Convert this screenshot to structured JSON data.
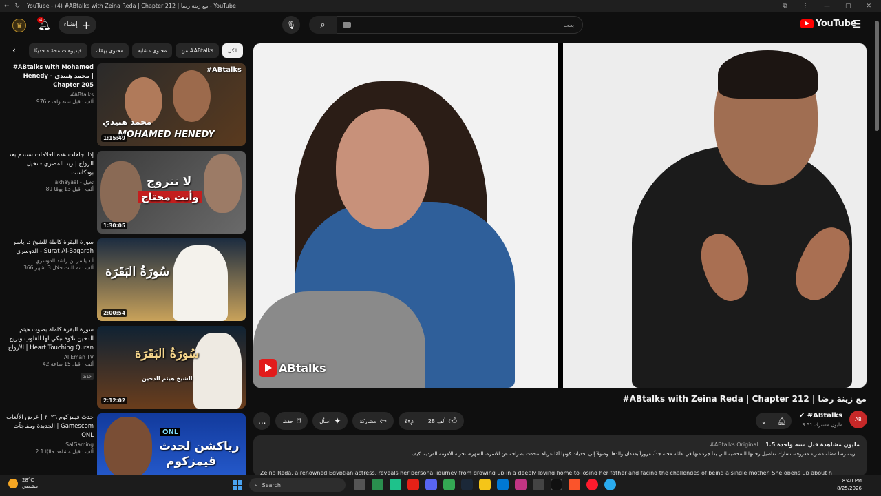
{
  "window": {
    "title": "YouTube - (4) #ABtalks with Zeina Reda | Chapter 212 | مع زينة رضا - YouTube"
  },
  "header": {
    "notifications_count": "4",
    "create_label": "إنشاء",
    "search_placeholder": "بحث",
    "logo_text": "YouTube"
  },
  "chips": [
    {
      "label": "الكل",
      "active": true
    },
    {
      "label": "من #ABtalks"
    },
    {
      "label": "محتوى مشابه"
    },
    {
      "label": "محتوى يهمّك"
    },
    {
      "label": "فيديوهات محمّلة حديثًا"
    }
  ],
  "recommendations": [
    {
      "title": "#ABtalks with Mohamed Henedy - محمد هنيدي | Chapter 205",
      "channel": "#ABtalks",
      "views": "976 ألف",
      "age": "قبل سنة واحدة",
      "duration": "1:15:49",
      "thumb_text1": "#ABtalks",
      "thumb_text2": "محمد هنيدي",
      "thumb_text3": "MOHAMED HENEDY"
    },
    {
      "title": "إذا تجاهلت هذه العلامات ستندم بعد الزواج | زيد المصري - تخيل بودكاست",
      "channel": "Takhayaal - تخيل",
      "views": "89 ألف",
      "age": "قبل 13 يومًا",
      "duration": "1:30:05",
      "thumb_text1": "لا تتزوج",
      "thumb_text2": "وأنت محتاج"
    },
    {
      "title": "سورة البقرة كاملة للشيخ د. ياسر الدوسري - Surat Al-Baqarah",
      "channel": "أ.د ياسر بن راشد الدوسري",
      "views": "366 ألف",
      "age": "تم البث خلال 3 أشهر",
      "duration": "2:00:54",
      "thumb_text1": "سُورَةُ البَقَرَة"
    },
    {
      "title": "سورة البقرة كاملة بصوت هيثم الدخين تلاوة تبكي لها القلوب وتريح الأرواح | Heart Touching Quran",
      "channel": "Al Eman TV",
      "views": "42 ألف",
      "age": "قبل 15 ساعة",
      "duration": "2:12:02",
      "badge": "جديد",
      "thumb_text1": "سُورَةُ البَقَرَة",
      "thumb_text2": "الشيخ هيثم الدخين"
    },
    {
      "title": "حدث قيمزكوم ٢٠٢٦ | عرض الألعاب الجديدة ومفاجآت | Gamescom ONL",
      "channel": "SalGaming",
      "views": "2.1 ألف",
      "age": "قبل مشاهد حاليًا",
      "duration": "",
      "thumb_text1": "رياكشن لحدث",
      "thumb_text2": "قيمزكوم",
      "thumb_text3": "ONL"
    }
  ],
  "player": {
    "watermark": "ABtalks"
  },
  "video": {
    "title": "#ABtalks with Zeina Reda | Chapter 212 | مع زينة رضا",
    "channel": "#ABtalks",
    "subscribers": "3.51 مليون مشترك",
    "likes": "28 ألف",
    "share_label": "مشاركة",
    "ask_label": "اسأل",
    "save_label": "حفظ",
    "more_label": "...",
    "views_line": "1.5 مليون مشاهدة  قبل سنة واحدة",
    "original_tag": "#ABtalks Original",
    "desc_ar": "زينة رضا ممثلة مصرية معروفة، تشارك تفاصيل رحلتها الشخصية التي بدأ جزء منها في عائلة محبة جداً، مروراً بفقدان والدها، وصولاً إلى تحديات كونها أمًا عزباء. تتحدث بصراحة عن الأسرة، الشهرة، تجربة الأمومة الفردية، كيف...",
    "desc_en": "Zeina Reda, a renowned Egyptian actress, reveals her personal journey from growing up in a deeply loving home to losing her father and facing the challenges of being a single mother. She opens up about h"
  },
  "taskbar": {
    "temp": "28°C",
    "weather": "مشمس",
    "search_label": "Search",
    "time": "8:40 PM",
    "date": "8/25/2026"
  }
}
